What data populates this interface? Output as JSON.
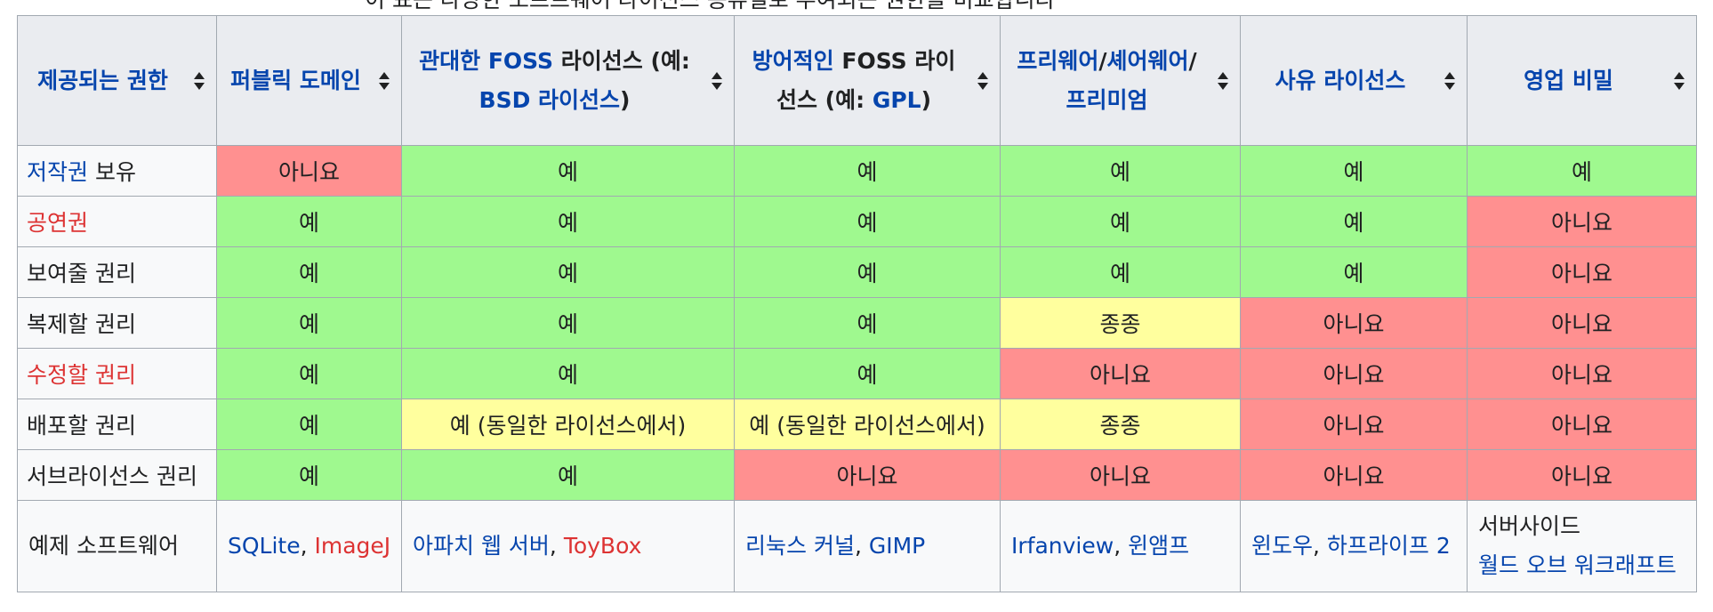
{
  "caption_clip": "이 표는 다양한 소프트웨어 라이선스 종류별로 부여되는 권한을 비교합니다",
  "headers": [
    {
      "parts": [
        {
          "t": "제공되는 권한",
          "c": "lk"
        }
      ]
    },
    {
      "parts": [
        {
          "t": "퍼블릭 도메인",
          "c": "lk"
        }
      ]
    },
    {
      "parts": [
        {
          "t": "관대한",
          "c": "lk"
        },
        {
          "t": " FOSS",
          "c": "lk"
        },
        {
          "t": " 라이선스 (예: ",
          "c": "dk"
        },
        {
          "t": "BSD 라이선스",
          "c": "lk"
        },
        {
          "t": ")",
          "c": "dk"
        }
      ]
    },
    {
      "parts": [
        {
          "t": "방어적인",
          "c": "lk"
        },
        {
          "t": " FOSS 라이선스 (예: ",
          "c": "dk"
        },
        {
          "t": "GPL",
          "c": "lk"
        },
        {
          "t": ")",
          "c": "dk"
        }
      ]
    },
    {
      "parts": [
        {
          "t": "프리웨어",
          "c": "lk"
        },
        {
          "t": "/",
          "c": "dk"
        },
        {
          "t": "셰어웨어",
          "c": "lk"
        },
        {
          "t": "/",
          "c": "dk"
        },
        {
          "t": "프리미엄",
          "c": "lk"
        }
      ]
    },
    {
      "parts": [
        {
          "t": "사유 라이선스",
          "c": "lk"
        }
      ]
    },
    {
      "parts": [
        {
          "t": "영업 비밀",
          "c": "lk"
        }
      ]
    }
  ],
  "rows": [
    {
      "label": [
        {
          "t": "저작권",
          "c": "lk"
        },
        {
          "t": " 보유",
          "c": "dk"
        }
      ],
      "cells": [
        {
          "v": "아니요",
          "s": "no"
        },
        {
          "v": "예",
          "s": "yes"
        },
        {
          "v": "예",
          "s": "yes"
        },
        {
          "v": "예",
          "s": "yes"
        },
        {
          "v": "예",
          "s": "yes"
        },
        {
          "v": "예",
          "s": "yes"
        }
      ]
    },
    {
      "label": [
        {
          "t": "공연권",
          "c": "rd"
        }
      ],
      "cells": [
        {
          "v": "예",
          "s": "yes"
        },
        {
          "v": "예",
          "s": "yes"
        },
        {
          "v": "예",
          "s": "yes"
        },
        {
          "v": "예",
          "s": "yes"
        },
        {
          "v": "예",
          "s": "yes"
        },
        {
          "v": "아니요",
          "s": "no"
        }
      ]
    },
    {
      "label": [
        {
          "t": "보여줄 권리",
          "c": "dk"
        }
      ],
      "cells": [
        {
          "v": "예",
          "s": "yes"
        },
        {
          "v": "예",
          "s": "yes"
        },
        {
          "v": "예",
          "s": "yes"
        },
        {
          "v": "예",
          "s": "yes"
        },
        {
          "v": "예",
          "s": "yes"
        },
        {
          "v": "아니요",
          "s": "no"
        }
      ]
    },
    {
      "label": [
        {
          "t": "복제할 권리",
          "c": "dk"
        }
      ],
      "cells": [
        {
          "v": "예",
          "s": "yes"
        },
        {
          "v": "예",
          "s": "yes"
        },
        {
          "v": "예",
          "s": "yes"
        },
        {
          "v": "종종",
          "s": "some"
        },
        {
          "v": "아니요",
          "s": "no"
        },
        {
          "v": "아니요",
          "s": "no"
        }
      ]
    },
    {
      "label": [
        {
          "t": "수정할 권리",
          "c": "rd"
        }
      ],
      "cells": [
        {
          "v": "예",
          "s": "yes"
        },
        {
          "v": "예",
          "s": "yes"
        },
        {
          "v": "예",
          "s": "yes"
        },
        {
          "v": "아니요",
          "s": "no"
        },
        {
          "v": "아니요",
          "s": "no"
        },
        {
          "v": "아니요",
          "s": "no"
        }
      ]
    },
    {
      "label": [
        {
          "t": "배포할 권리",
          "c": "dk"
        }
      ],
      "cells": [
        {
          "v": "예",
          "s": "yes"
        },
        {
          "v": "예 (동일한 라이선스에서)",
          "s": "some"
        },
        {
          "v": "예 (동일한 라이선스에서)",
          "s": "some"
        },
        {
          "v": "종종",
          "s": "some"
        },
        {
          "v": "아니요",
          "s": "no"
        },
        {
          "v": "아니요",
          "s": "no"
        }
      ]
    },
    {
      "label": [
        {
          "t": "서브라이선스 권리",
          "c": "dk"
        }
      ],
      "cells": [
        {
          "v": "예",
          "s": "yes"
        },
        {
          "v": "예",
          "s": "yes"
        },
        {
          "v": "아니요",
          "s": "no"
        },
        {
          "v": "아니요",
          "s": "no"
        },
        {
          "v": "아니요",
          "s": "no"
        },
        {
          "v": "아니요",
          "s": "no"
        }
      ]
    }
  ],
  "example": {
    "label": "예제 소프트웨어",
    "cells": [
      [
        {
          "t": "SQLite",
          "c": "lk"
        },
        {
          "t": ", ",
          "c": "dk"
        },
        {
          "t": "ImageJ",
          "c": "rd"
        }
      ],
      [
        {
          "t": "아파치 웹 서버",
          "c": "lk"
        },
        {
          "t": ", ",
          "c": "dk"
        },
        {
          "t": "ToyBox",
          "c": "rd"
        }
      ],
      [
        {
          "t": "리눅스 커널",
          "c": "lk"
        },
        {
          "t": ", ",
          "c": "dk"
        },
        {
          "t": "GIMP",
          "c": "lk"
        }
      ],
      [
        {
          "t": "Irfanview",
          "c": "lk"
        },
        {
          "t": ", ",
          "c": "dk"
        },
        {
          "t": "윈앰프",
          "c": "lk"
        }
      ],
      [
        {
          "t": "윈도우",
          "c": "lk"
        },
        {
          "t": ", ",
          "c": "dk"
        },
        {
          "t": "하프라이프 2",
          "c": "lk"
        }
      ],
      [
        {
          "t": "서버사이드",
          "c": "dk"
        },
        {
          "t": "\n",
          "c": "br"
        },
        {
          "t": "월드 오브 워크래프트",
          "c": "lk"
        }
      ]
    ]
  },
  "colors": {
    "yes": "#9ff98f",
    "no": "#ff9090",
    "some": "#ffff9e",
    "link": "#0645ad",
    "redlink": "#d33",
    "header_bg": "#eaecf0"
  },
  "icons": {
    "sort": "sort-arrows-icon"
  }
}
